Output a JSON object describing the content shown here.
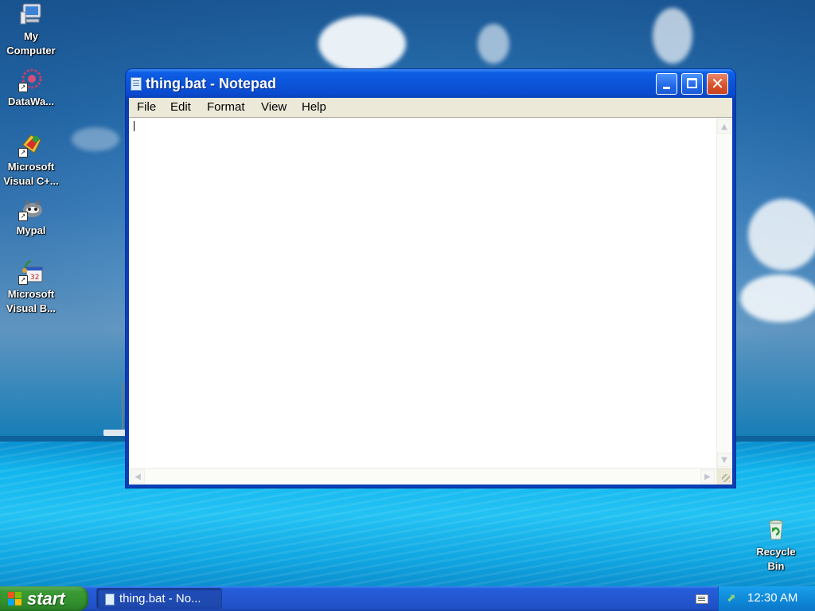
{
  "desktop": {
    "icons": [
      {
        "label_line1": "My",
        "label_line2": "Computer",
        "icon": "my-computer-icon"
      },
      {
        "label_line1": "DataWa...",
        "label_line2": "",
        "icon": "datawatch-icon"
      },
      {
        "label_line1": "Microsoft",
        "label_line2": "Visual C+...",
        "icon": "visual-cpp-icon"
      },
      {
        "label_line1": "Mypal",
        "label_line2": "",
        "icon": "mypal-icon"
      },
      {
        "label_line1": "Microsoft",
        "label_line2": "Visual B...",
        "icon": "visual-basic-icon"
      },
      {
        "label_line1": "Recycle",
        "label_line2": "Bin",
        "icon": "recycle-bin-icon"
      }
    ]
  },
  "window": {
    "title": "thing.bat - Notepad",
    "close_glyph": "✕",
    "menu": [
      "File",
      "Edit",
      "Format",
      "View",
      "Help"
    ],
    "content": ""
  },
  "taskbar": {
    "start_label": "start",
    "task_button_label": "thing.bat - No...",
    "clock": "12:30 AM"
  },
  "colors": {
    "titlebar": "#0a54d8",
    "taskbar": "#245edb",
    "start_button": "#3c9a37",
    "close_button": "#d9542c",
    "menu_bg": "#ece9d8"
  }
}
